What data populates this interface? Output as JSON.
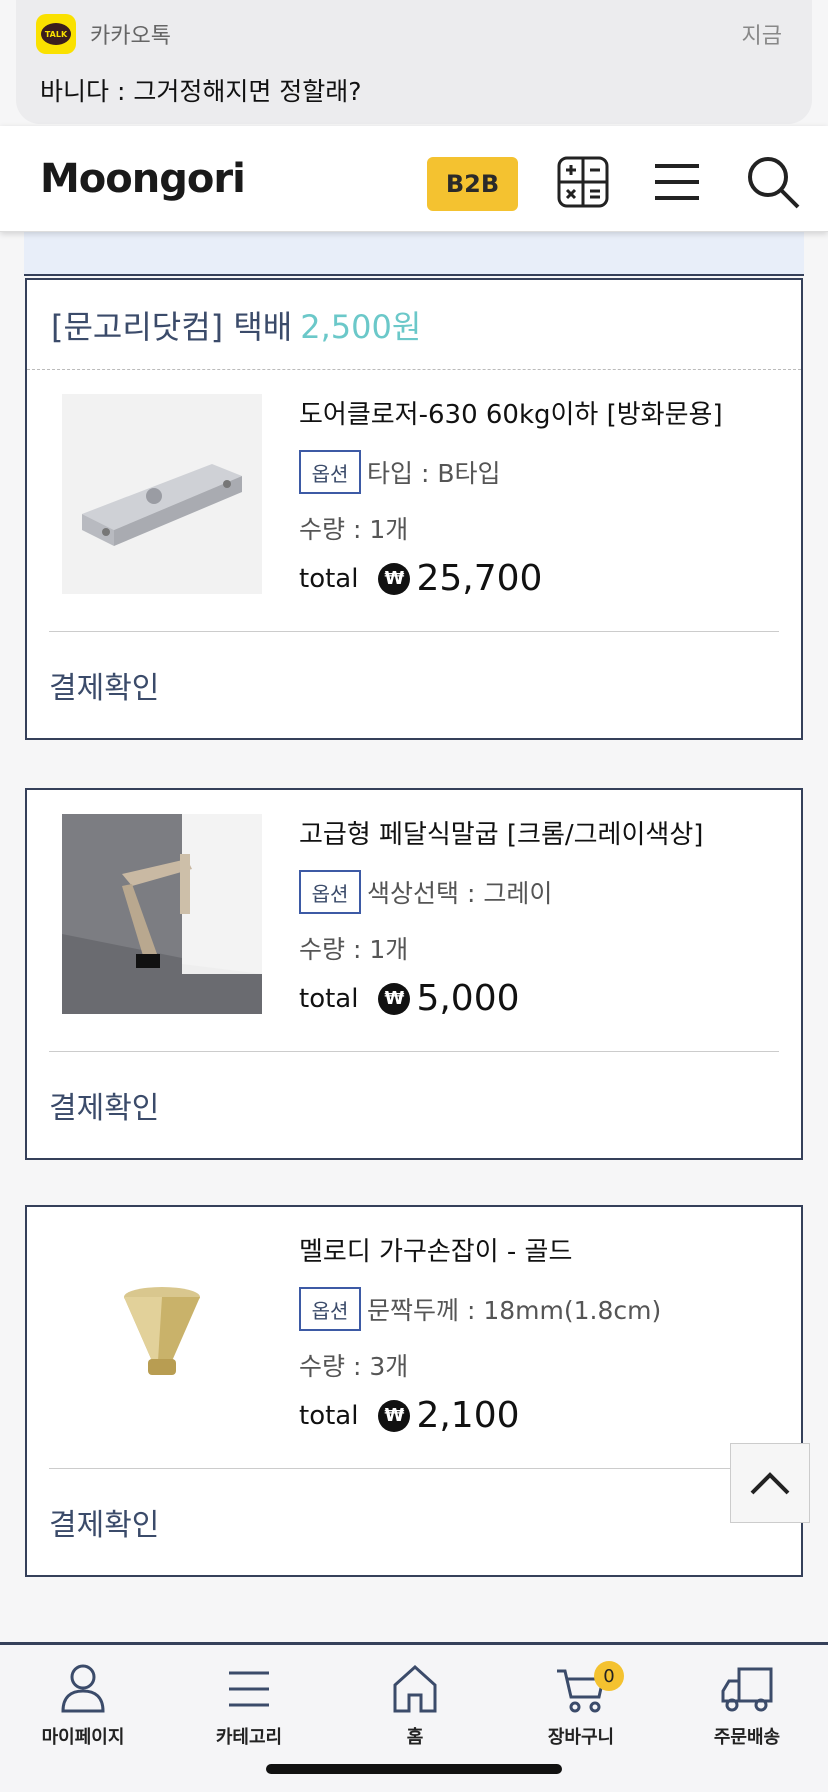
{
  "notification": {
    "app": "카카오톡",
    "icon_text": "TALK",
    "time": "지금",
    "message": "바니다 : 그거정해지면 정할래?"
  },
  "header": {
    "logo": "Moongori",
    "b2b_label": "B2B",
    "icons": [
      "calculator-icon",
      "menu-icon",
      "search-icon"
    ]
  },
  "order": {
    "seller_header": {
      "shop": "[문고리닷컴] 택배",
      "shipping_fee": "2,500원"
    },
    "items": [
      {
        "name": "도어클로저-630 60kg이하  [방화문용]",
        "option_badge": "옵션",
        "option_text": "타입 : B타입",
        "quantity": "수량 : 1개",
        "total_label": "total",
        "currency": "₩",
        "price": "25,700",
        "confirm_label": "결제확인"
      },
      {
        "name": "고급형 페달식말굽 [크롬/그레이색상]",
        "option_badge": "옵션",
        "option_text": "색상선택 : 그레이",
        "quantity": "수량 : 1개",
        "total_label": "total",
        "currency": "₩",
        "price": "5,000",
        "confirm_label": "결제확인"
      },
      {
        "name": "멜로디 가구손잡이 - 골드",
        "option_badge": "옵션",
        "option_text": "문짝두께 : 18mm(1.8cm)",
        "quantity": "수량 : 3개",
        "total_label": "total",
        "currency": "₩",
        "price": "2,100",
        "confirm_label": "결제확인"
      }
    ]
  },
  "bottom_nav": {
    "items": [
      {
        "label": "마이페이지",
        "icon": "user-icon"
      },
      {
        "label": "카테고리",
        "icon": "menu-icon"
      },
      {
        "label": "홈",
        "icon": "home-icon"
      },
      {
        "label": "장바구니",
        "icon": "cart-icon"
      },
      {
        "label": "주문배송",
        "icon": "truck-icon"
      }
    ],
    "cart_count": "0"
  },
  "colors": {
    "accent_yellow": "#f4c230",
    "navy": "#35405a",
    "teal": "#6bc8c9",
    "option_border": "#3d5aa5"
  }
}
